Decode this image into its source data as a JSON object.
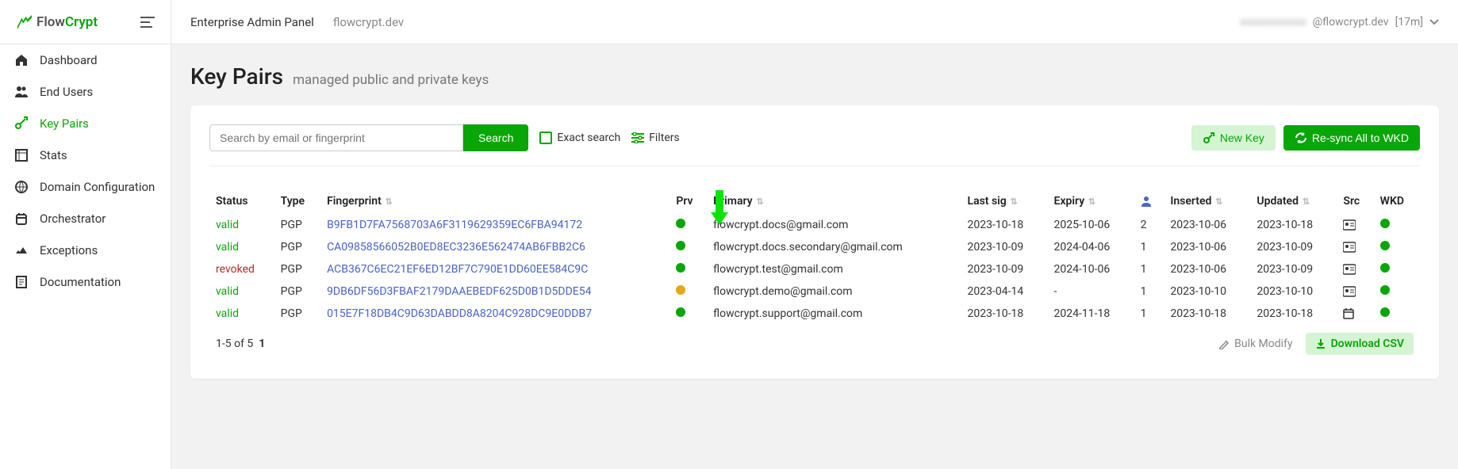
{
  "brand": {
    "flow": "Flow",
    "crypt": "Crypt"
  },
  "sidebar": {
    "items": [
      {
        "label": "Dashboard"
      },
      {
        "label": "End Users"
      },
      {
        "label": "Key Pairs"
      },
      {
        "label": "Stats"
      },
      {
        "label": "Domain Configuration"
      },
      {
        "label": "Orchestrator"
      },
      {
        "label": "Exceptions"
      },
      {
        "label": "Documentation"
      }
    ],
    "active_index": 2
  },
  "topbar": {
    "panel": "Enterprise Admin Panel",
    "domain": "flowcrypt.dev",
    "user_suffix": "@flowcrypt.dev",
    "session": "[17m]"
  },
  "page": {
    "title": "Key Pairs",
    "subtitle": "managed public and private keys"
  },
  "search": {
    "placeholder": "Search by email or fingerprint",
    "button": "Search",
    "exact": "Exact search",
    "filters": "Filters"
  },
  "toolbar": {
    "new_key": "New Key",
    "resync": "Re-sync All to WKD"
  },
  "columns": {
    "status": "Status",
    "type": "Type",
    "fingerprint": "Fingerprint",
    "prv": "Prv",
    "primary": "Primary",
    "last_sig": "Last sig",
    "expiry": "Expiry",
    "users": "",
    "inserted": "Inserted",
    "updated": "Updated",
    "src": "Src",
    "wkd": "WKD"
  },
  "rows": [
    {
      "status": "valid",
      "status_class": "status-valid",
      "type": "PGP",
      "fingerprint": "B9FB1D7FA7568703A6F3119629359EC6FBA94172",
      "prv": "green",
      "primary": "flowcrypt.docs@gmail.com",
      "last_sig": "2023-10-18",
      "expiry": "2025-10-06",
      "users": "2",
      "inserted": "2023-10-06",
      "updated": "2023-10-18",
      "src_icon": "id-card",
      "wkd": "green"
    },
    {
      "status": "valid",
      "status_class": "status-valid",
      "type": "PGP",
      "fingerprint": "CA09858566052B0ED8EC3236E562474AB6FBB2C6",
      "prv": "green",
      "primary": "flowcrypt.docs.secondary@gmail.com",
      "last_sig": "2023-10-09",
      "expiry": "2024-04-06",
      "users": "1",
      "inserted": "2023-10-06",
      "updated": "2023-10-09",
      "src_icon": "id-card",
      "wkd": "green"
    },
    {
      "status": "revoked",
      "status_class": "status-revoked",
      "type": "PGP",
      "fingerprint": "ACB367C6EC21EF6ED12BF7C790E1DD60EE584C9C",
      "prv": "green",
      "primary": "flowcrypt.test@gmail.com",
      "last_sig": "2023-10-09",
      "expiry": "2024-10-06",
      "users": "1",
      "inserted": "2023-10-06",
      "updated": "2023-10-09",
      "src_icon": "id-card",
      "wkd": "green"
    },
    {
      "status": "valid",
      "status_class": "status-valid",
      "type": "PGP",
      "fingerprint": "9DB6DF56D3FBAF2179DAAEBEDF625D0B1D5DDE54",
      "prv": "orange",
      "primary": "flowcrypt.demo@gmail.com",
      "last_sig": "2023-04-14",
      "expiry": "-",
      "users": "1",
      "inserted": "2023-10-10",
      "updated": "2023-10-10",
      "src_icon": "id-card",
      "wkd": "green"
    },
    {
      "status": "valid",
      "status_class": "status-valid",
      "type": "PGP",
      "fingerprint": "015E7F18DB4C9D63DABDD8A8204C928DC9E0DDB7",
      "prv": "green",
      "primary": "flowcrypt.support@gmail.com",
      "last_sig": "2023-10-18",
      "expiry": "2024-11-18",
      "users": "1",
      "inserted": "2023-10-18",
      "updated": "2023-10-18",
      "src_icon": "calendar",
      "wkd": "green"
    }
  ],
  "footer": {
    "range": "1-5 of 5",
    "page": "1",
    "bulk": "Bulk Modify",
    "download": "Download CSV"
  }
}
